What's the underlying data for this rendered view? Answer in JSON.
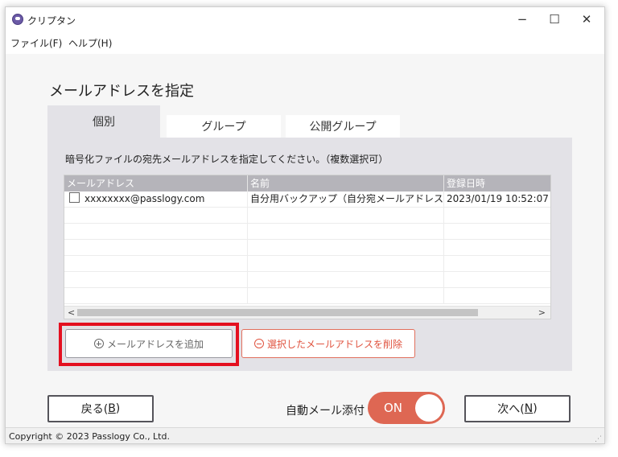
{
  "window": {
    "title": "クリプタン",
    "minimize_glyph": "−",
    "maximize_glyph": "☐",
    "close_glyph": "✕"
  },
  "menu": {
    "file": "ファイル(F)",
    "help": "ヘルプ(H)"
  },
  "page": {
    "title": "メールアドレスを指定"
  },
  "tabs": [
    {
      "label": "個別",
      "selected": true
    },
    {
      "label": "グループ",
      "selected": false
    },
    {
      "label": "公開グループ",
      "selected": false
    }
  ],
  "panel": {
    "instruction": "暗号化ファイルの宛先メールアドレスを指定してください。（複数選択可）"
  },
  "table": {
    "headers": [
      "メールアドレス",
      "名前",
      "登録日時"
    ],
    "rows": [
      {
        "email": "xxxxxxxx@passlogy.com",
        "name": "自分用バックアップ（自分宛メールアドレス）",
        "date": "2023/01/19 10:52:07",
        "checked": false
      }
    ],
    "scroll_left": "<",
    "scroll_right": ">"
  },
  "buttons": {
    "add_email": "メールアドレスを追加",
    "delete_selected": "選択したメールアドレスを削除",
    "back_label": "戻る(",
    "back_key": "B",
    "back_close": ")",
    "next_label": "次へ(",
    "next_key": "N",
    "next_close": ")"
  },
  "auto_attach": {
    "label": "自動メール添付",
    "state": "ON"
  },
  "status": {
    "copyright": "Copyright © 2023 Passlogy Co., Ltd."
  },
  "colors": {
    "accent": "#de6753",
    "highlight": "#e41020",
    "panel": "#e3e2e7",
    "header": "#b5b4ba"
  }
}
